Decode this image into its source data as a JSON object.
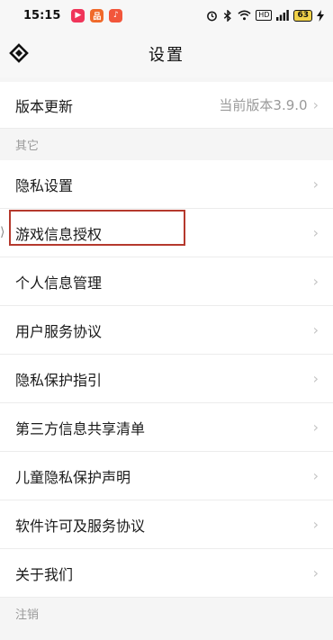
{
  "status_bar": {
    "time": "15:15",
    "apps": [
      {
        "icon": "video-app-icon",
        "glyph": "▶",
        "color": "#f0355a"
      },
      {
        "icon": "shop-app-icon",
        "glyph": "品",
        "color": "#f06a2b"
      },
      {
        "icon": "music-app-icon",
        "glyph": "♪",
        "color": "#f2563b"
      }
    ],
    "battery": "63"
  },
  "header": {
    "title": "设置"
  },
  "version_row": {
    "label": "版本更新",
    "value": "当前版本3.9.0"
  },
  "sections": {
    "other": "其它",
    "logout": "注销"
  },
  "items": [
    {
      "label": "隐私设置"
    },
    {
      "label": "游戏信息授权"
    },
    {
      "label": "个人信息管理"
    },
    {
      "label": "用户服务协议"
    },
    {
      "label": "隐私保护指引"
    },
    {
      "label": "第三方信息共享清单"
    },
    {
      "label": "儿童隐私保护声明"
    },
    {
      "label": "软件许可及服务协议"
    },
    {
      "label": "关于我们"
    }
  ],
  "chevron": "›",
  "edge_tab_glyph": "⟩"
}
